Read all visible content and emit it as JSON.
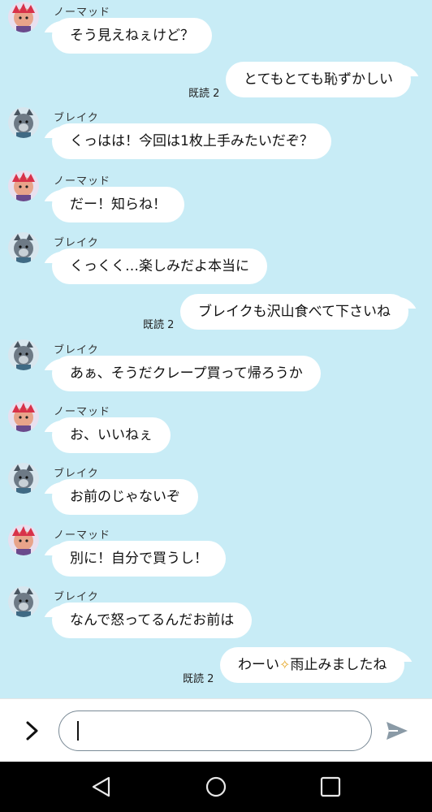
{
  "participants": {
    "nomad": {
      "name": "ノーマッド",
      "avatar_icon": "red-maned-character-avatar"
    },
    "break": {
      "name": "ブレイク",
      "avatar_icon": "gray-wolf-character-avatar"
    }
  },
  "messages": [
    {
      "dir": "in",
      "sender": "ノーマッド",
      "text": "そう見えねぇけど？"
    },
    {
      "dir": "out",
      "read": "既読 2",
      "text": "とてもとても恥ずかしい"
    },
    {
      "dir": "in",
      "sender": "ブレイク",
      "text": "くっはは！今回は1枚上手みたいだぞ？"
    },
    {
      "dir": "in",
      "sender": "ノーマッド",
      "text": "だー！知らね！"
    },
    {
      "dir": "in",
      "sender": "ブレイク",
      "text": "くっくく…楽しみだよ本当に"
    },
    {
      "dir": "out",
      "read": "既読 2",
      "text": "ブレイクも沢山食べて下さいね"
    },
    {
      "dir": "in",
      "sender": "ブレイク",
      "text": "あぁ、そうだクレープ買って帰ろうか"
    },
    {
      "dir": "in",
      "sender": "ノーマッド",
      "text": "お、いいねぇ"
    },
    {
      "dir": "in",
      "sender": "ブレイク",
      "text": "お前のじゃないぞ"
    },
    {
      "dir": "in",
      "sender": "ノーマッド",
      "text": "別に！自分で買うし！"
    },
    {
      "dir": "in",
      "sender": "ブレイク",
      "text": "なんで怒ってるんだお前は"
    },
    {
      "dir": "out",
      "read": "既読 2",
      "text_before": "わーい",
      "emoji": "sparkle-icon",
      "text_after": "雨止みましたね"
    }
  ],
  "composer": {
    "value": "",
    "expand_icon": "chevron-right-icon",
    "send_icon": "send-icon"
  },
  "navbar": {
    "back_icon": "back-triangle-icon",
    "home_icon": "home-circle-icon",
    "recents_icon": "recents-square-icon"
  },
  "colors": {
    "chat_background": "#c8ecf6",
    "bubble": "#ffffff",
    "send_icon": "#8a9aa6"
  }
}
